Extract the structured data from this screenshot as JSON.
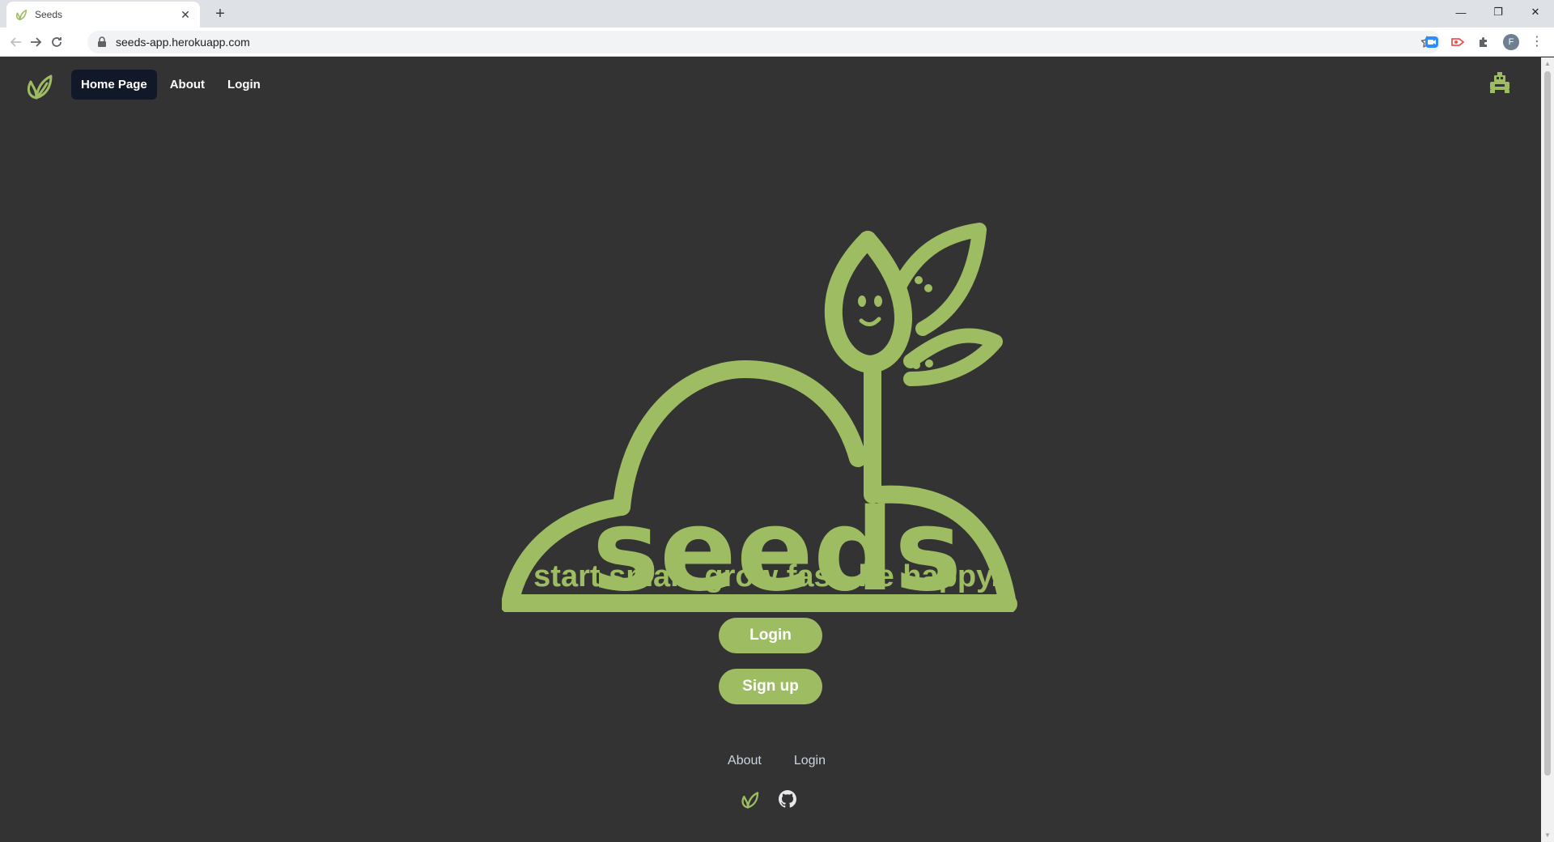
{
  "browser": {
    "tab_title": "Seeds",
    "url": "seeds-app.herokuapp.com",
    "profile_initial": "F"
  },
  "nav": {
    "items": [
      {
        "label": "Home Page",
        "active": true
      },
      {
        "label": "About"
      },
      {
        "label": "Login"
      }
    ]
  },
  "hero": {
    "wordmark": "seeds",
    "tagline": "start small. grow fast. be happy.",
    "caret": "|"
  },
  "actions": {
    "login_label": "Login",
    "signup_label": "Sign up"
  },
  "footer": {
    "links": [
      "About",
      "Login"
    ]
  },
  "colors": {
    "brand_green": "#9ebd63",
    "background": "#333333",
    "active_nav_bg": "#111827"
  }
}
